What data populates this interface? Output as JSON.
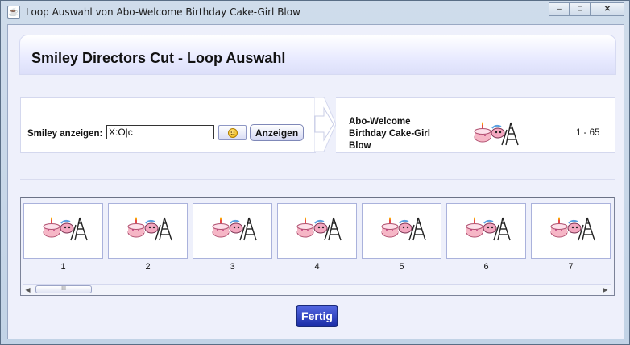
{
  "window": {
    "title": "Loop Auswahl von Abo-Welcome Birthday Cake-Girl Blow",
    "minimize": "–",
    "maximize": "□",
    "close": "✕"
  },
  "header": {
    "title": "Smiley Directors Cut - Loop Auswahl"
  },
  "search": {
    "label": "Smiley anzeigen:",
    "value": "X:O|c",
    "show_button": "Anzeigen",
    "smiley_icon": "smiley-face-icon"
  },
  "info": {
    "name": "Abo-Welcome Birthday Cake-Girl Blow",
    "range": "1 - 65",
    "icon": "cake-ladder-icon"
  },
  "frames": [
    {
      "number": "1"
    },
    {
      "number": "2"
    },
    {
      "number": "3"
    },
    {
      "number": "4"
    },
    {
      "number": "5"
    },
    {
      "number": "6"
    },
    {
      "number": "7"
    }
  ],
  "scrollbar": {
    "left_arrow": "◀",
    "right_arrow": "▶",
    "thumb_grip": "III"
  },
  "footer": {
    "done_button": "Fertig"
  },
  "colors": {
    "accent": "#1d2fa8",
    "panel_border": "#aab2dc"
  }
}
